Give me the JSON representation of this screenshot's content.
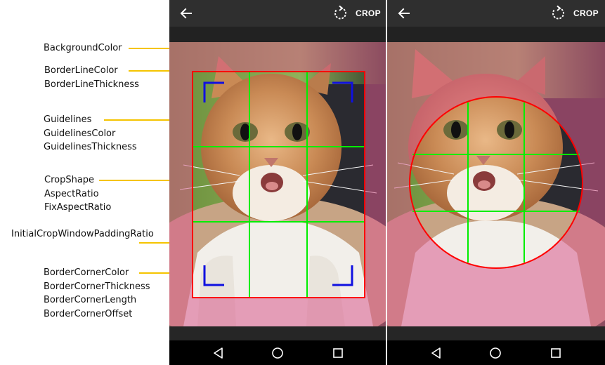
{
  "labels": {
    "background": [
      "BackgroundColor"
    ],
    "border_line": [
      "BorderLineColor",
      "BorderLineThickness"
    ],
    "guidelines": [
      "Guidelines",
      "GuidelinesColor",
      "GuidelinesThickness"
    ],
    "crop_shape": [
      "CropShape",
      "AspectRatio",
      "FixAspectRatio"
    ],
    "padding": [
      "InitialCropWindowPaddingRatio"
    ],
    "border_corner": [
      "BorderCornerColor",
      "BorderCornerThickness",
      "BorderCornerLength",
      "BorderCornerOffset"
    ]
  },
  "screens": [
    {
      "toolbar": {
        "back_icon": "arrow-left-icon",
        "rotate_icon": "rotate-icon",
        "crop_label": "CROP"
      },
      "crop_shape": "rectangle"
    },
    {
      "toolbar": {
        "back_icon": "arrow-left-icon",
        "rotate_icon": "rotate-icon",
        "crop_label": "CROP"
      },
      "crop_shape": "oval"
    }
  ],
  "navbar": {
    "icons": [
      "back-triangle-icon",
      "home-circle-icon",
      "recents-square-icon"
    ]
  },
  "colors": {
    "arrow": "#f5c400",
    "border_line": "#ff0000",
    "guidelines": "#00ee00",
    "border_corner": "#1010e0",
    "background_overlay": "#d85a8c"
  }
}
